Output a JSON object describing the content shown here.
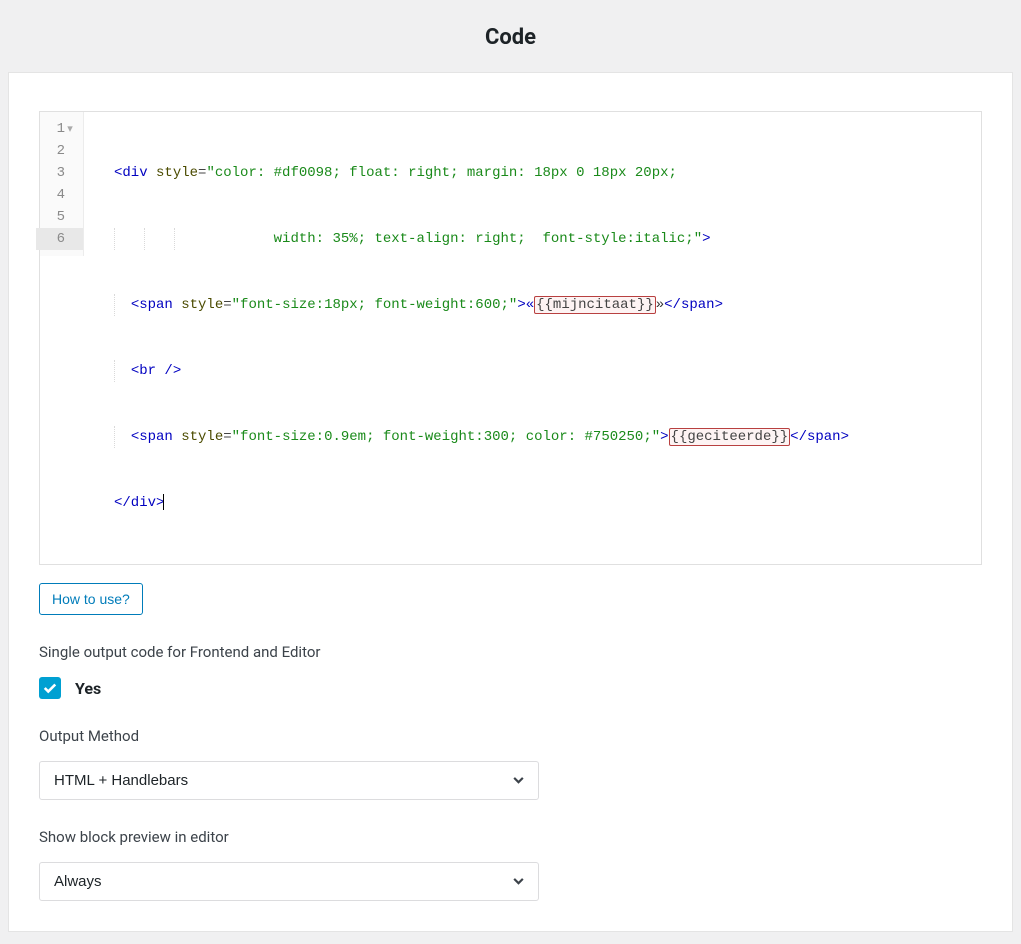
{
  "title": "Code",
  "editor": {
    "lineNumbers": [
      "1",
      "2",
      "3",
      "4",
      "5",
      "6"
    ],
    "foldRow": 0,
    "activeGutter": 5,
    "code": {
      "l1_tag_open": "<div",
      "l1_attr": " style",
      "l1_eq": "=",
      "l1_val": "\"color: #df0098; float: right; margin: 18px 0 18px 20px;",
      "l2_val": "       width: 35%; text-align: right;  font-style:italic;\"",
      "l2_close": ">",
      "l3_open": "<span",
      "l3_attr": " style",
      "l3_eq": "=",
      "l3_val": "\"font-size:18px; font-weight:600;\"",
      "l3_close": ">«",
      "l3_hb": "{{mijncitaat}}",
      "l3_after": "»",
      "l3_end": "</span>",
      "l4": "<br />",
      "l5_open": "<span",
      "l5_attr": " style",
      "l5_eq": "=",
      "l5_val": "\"font-size:0.9em; font-weight:300; color: #750250;\"",
      "l5_close": ">",
      "l5_hb": "{{geciteerde}}",
      "l5_end": "</span>",
      "l6": "</div>"
    }
  },
  "howToUse": "How to use?",
  "singleOutput": {
    "label": "Single output code for Frontend and Editor",
    "checkboxLabel": "Yes",
    "checked": true
  },
  "outputMethod": {
    "label": "Output Method",
    "value": "HTML + Handlebars"
  },
  "preview": {
    "label": "Show block preview in editor",
    "value": "Always"
  }
}
